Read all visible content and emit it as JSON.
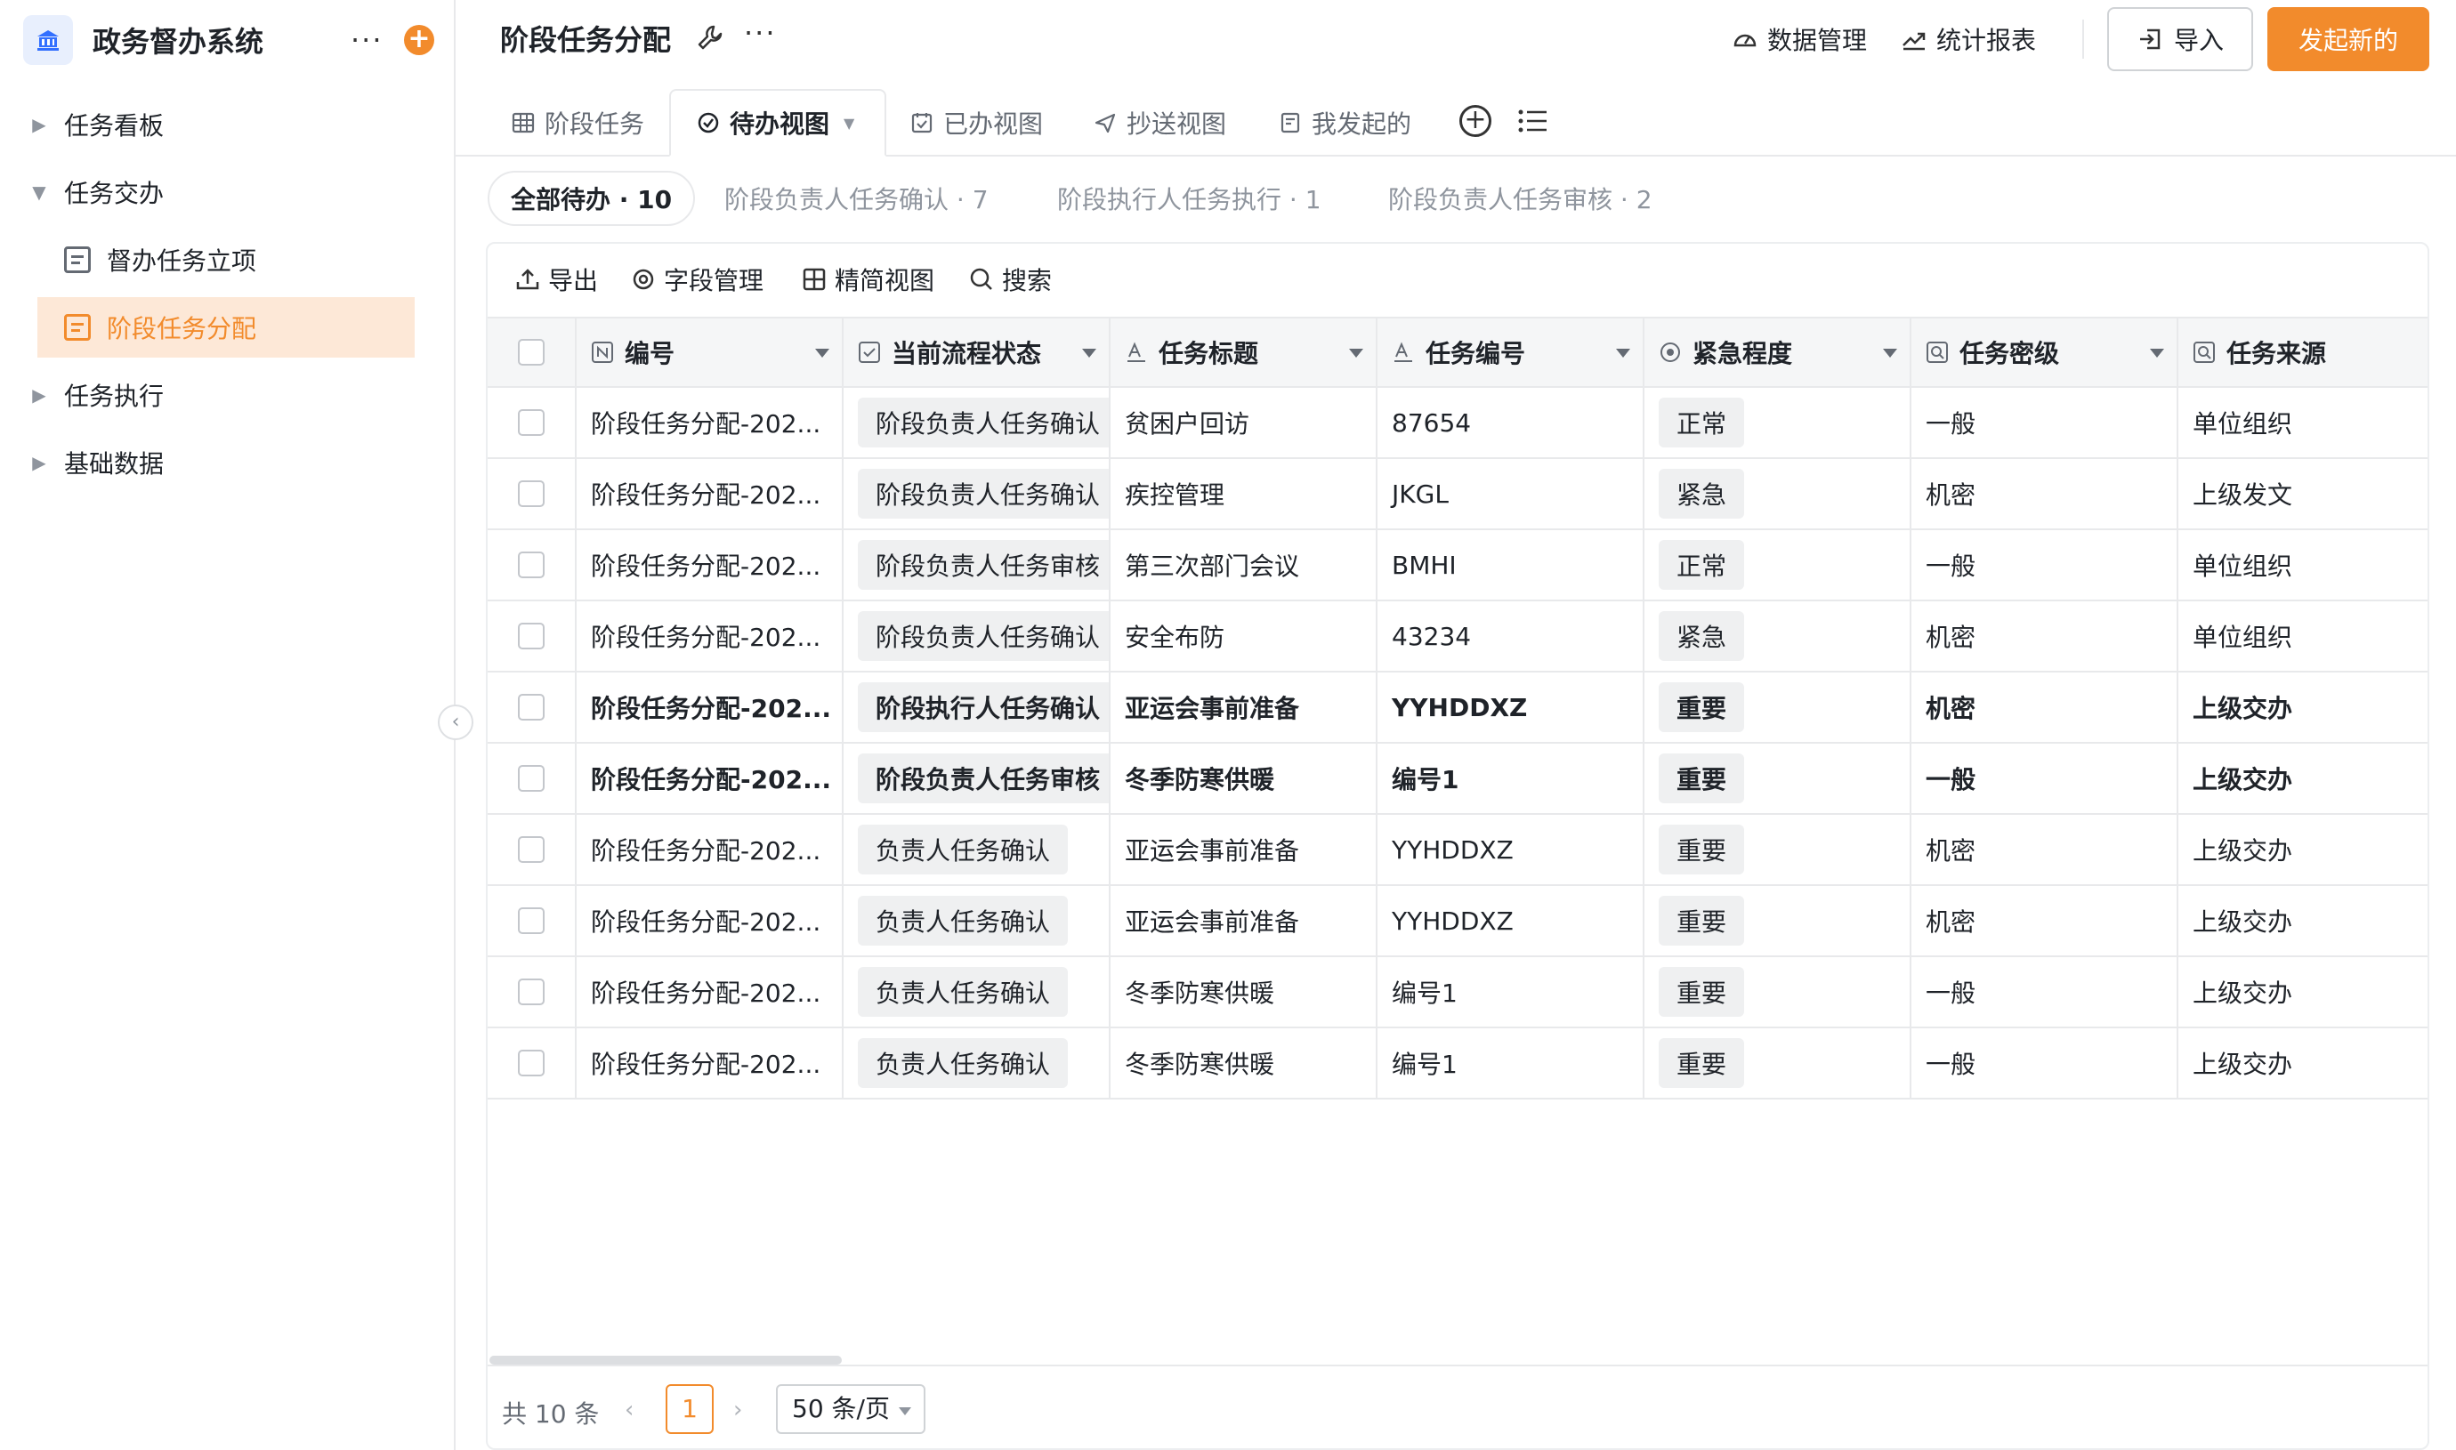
{
  "app": {
    "title": "政务督办系统"
  },
  "sidebar": {
    "items": [
      {
        "label": "任务看板"
      },
      {
        "label": "任务交办"
      },
      {
        "label": "督办任务立项"
      },
      {
        "label": "阶段任务分配"
      },
      {
        "label": "任务执行"
      },
      {
        "label": "基础数据"
      }
    ]
  },
  "header": {
    "title": "阶段任务分配",
    "data_manage": "数据管理",
    "stats_report": "统计报表",
    "import_label": "导入",
    "new_label": "发起新的"
  },
  "tabs": [
    {
      "label": "阶段任务"
    },
    {
      "label": "待办视图"
    },
    {
      "label": "已办视图"
    },
    {
      "label": "抄送视图"
    },
    {
      "label": "我发起的"
    }
  ],
  "filters": [
    {
      "label": "全部待办 · 10"
    },
    {
      "label": "阶段负责人任务确认 · 7"
    },
    {
      "label": "阶段执行人任务执行 · 1"
    },
    {
      "label": "阶段负责人任务审核 · 2"
    }
  ],
  "toolbar": {
    "export": "导出",
    "fields": "字段管理",
    "compact": "精简视图",
    "search": "搜索"
  },
  "table": {
    "columns": [
      "编号",
      "当前流程状态",
      "任务标题",
      "任务编号",
      "紧急程度",
      "任务密级",
      "任务来源"
    ],
    "rows": [
      [
        "阶段任务分配-202...",
        "阶段负责人任务确认",
        "贫困户回访",
        "87654",
        "正常",
        "一般",
        "单位组织"
      ],
      [
        "阶段任务分配-202...",
        "阶段负责人任务确认",
        "疾控管理",
        "JKGL",
        "紧急",
        "机密",
        "上级发文"
      ],
      [
        "阶段任务分配-202...",
        "阶段负责人任务审核",
        "第三次部门会议",
        "BMHI",
        "正常",
        "一般",
        "单位组织"
      ],
      [
        "阶段任务分配-202...",
        "阶段负责人任务确认",
        "安全布防",
        "43234",
        "紧急",
        "机密",
        "单位组织"
      ],
      [
        "阶段任务分配-202...",
        "阶段执行人任务确认",
        "亚运会事前准备",
        "YYHDDXZ",
        "重要",
        "机密",
        "上级交办"
      ],
      [
        "阶段任务分配-202...",
        "阶段负责人任务审核",
        "冬季防寒供暖",
        "编号1",
        "重要",
        "一般",
        "上级交办"
      ],
      [
        "阶段任务分配-202...",
        "负责人任务确认",
        "亚运会事前准备",
        "YYHDDXZ",
        "重要",
        "机密",
        "上级交办"
      ],
      [
        "阶段任务分配-202...",
        "负责人任务确认",
        "亚运会事前准备",
        "YYHDDXZ",
        "重要",
        "机密",
        "上级交办"
      ],
      [
        "阶段任务分配-202...",
        "负责人任务确认",
        "冬季防寒供暖",
        "编号1",
        "重要",
        "一般",
        "上级交办"
      ],
      [
        "阶段任务分配-202...",
        "负责人任务确认",
        "冬季防寒供暖",
        "编号1",
        "重要",
        "一般",
        "上级交办"
      ]
    ]
  },
  "pager": {
    "total": "共 10 条",
    "current": "1",
    "page_size": "50 条/页"
  },
  "colors": {
    "accent": "#f28b2c",
    "accent_bg": "#fde8d7"
  }
}
